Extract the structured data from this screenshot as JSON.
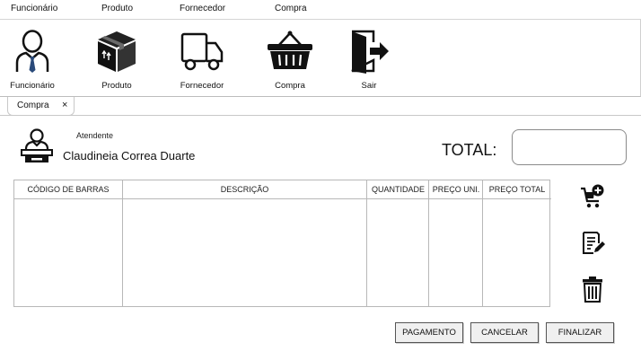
{
  "menu": [
    "Funcionário",
    "Produto",
    "Fornecedor",
    "Compra"
  ],
  "ribbon": [
    {
      "label": "Funcionário",
      "icon": "employee-icon"
    },
    {
      "label": "Produto",
      "icon": "product-box-icon"
    },
    {
      "label": "Fornecedor",
      "icon": "delivery-truck-icon"
    },
    {
      "label": "Compra",
      "icon": "shopping-basket-icon"
    },
    {
      "label": "Sair",
      "icon": "exit-door-icon"
    }
  ],
  "tab": {
    "label": "Compra",
    "close": "×"
  },
  "attendant": {
    "label": "Atendente",
    "name": "Claudineia Correa Duarte"
  },
  "total": {
    "label": "TOTAL:",
    "value": ""
  },
  "table": {
    "columns": [
      "CÓDIGO DE BARRAS",
      "DESCRIÇÃO",
      "QUANTIDADE",
      "PREÇO UNI.",
      "PREÇO TOTAL"
    ],
    "rows": []
  },
  "side_actions": [
    "add-to-cart-icon",
    "edit-document-icon",
    "trash-icon"
  ],
  "buttons": {
    "pagamento": "PAGAMENTO",
    "cancelar": "CANCELAR",
    "finalizar": "FINALIZAR"
  }
}
